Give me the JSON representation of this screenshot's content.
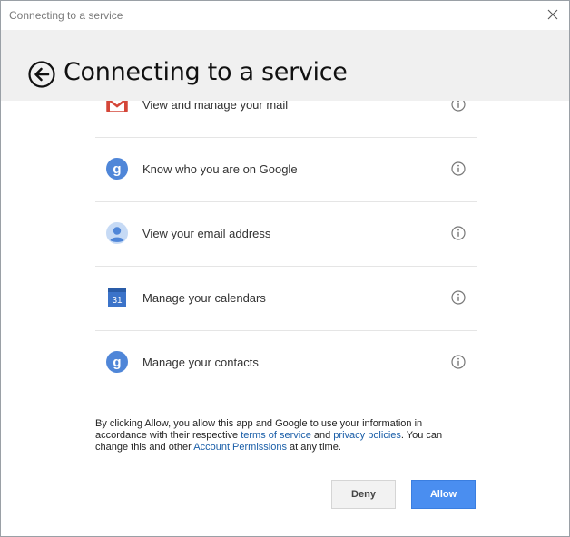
{
  "window": {
    "title": "Connecting to a service"
  },
  "header": {
    "heading": "Connecting to a service"
  },
  "permissions": [
    {
      "label": "View and manage your mail",
      "icon": "gmail-icon"
    },
    {
      "label": "Know who you are on Google",
      "icon": "google-g-icon"
    },
    {
      "label": "View your email address",
      "icon": "profile-avatar-icon"
    },
    {
      "label": "Manage your calendars",
      "icon": "calendar-icon",
      "icon_text": "31"
    },
    {
      "label": "Manage your contacts",
      "icon": "google-g-icon"
    }
  ],
  "consent": {
    "part1": "By clicking Allow, you allow this app and Google to use your information in accordance with their respective ",
    "terms_link": "terms of service",
    "part2": " and ",
    "privacy_link": "privacy policies",
    "part3": ". You can change this and other ",
    "account_link": "Account Permissions",
    "part4": " at any time."
  },
  "buttons": {
    "deny": "Deny",
    "allow": "Allow"
  },
  "colors": {
    "accent": "#4a8ef0",
    "link": "#1a5ea8",
    "header_bg": "#f0f0f0",
    "google_blue": "#4f86d8",
    "gmail_red": "#d44638"
  }
}
